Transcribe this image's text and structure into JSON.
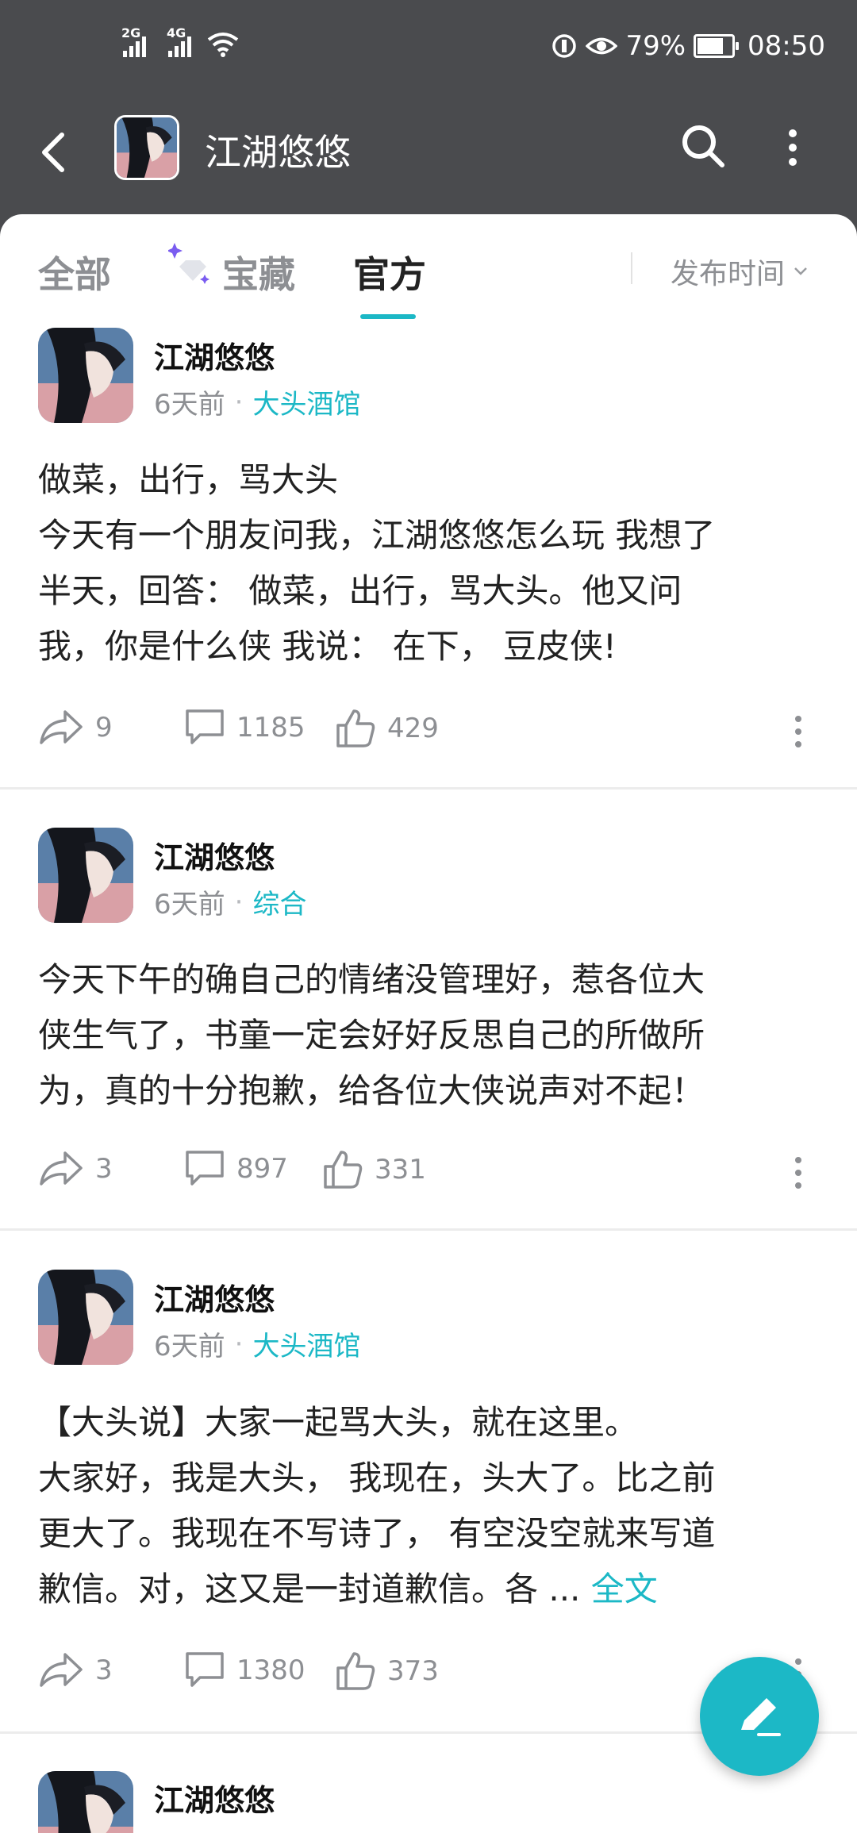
{
  "status_bar": {
    "net1": "2G",
    "net2": "4G",
    "battery_percent": "79%",
    "battery_level": 0.79,
    "time": "08:50"
  },
  "header": {
    "title": "江湖悠悠"
  },
  "tabs": [
    {
      "label": "全部"
    },
    {
      "label": "宝藏"
    },
    {
      "label": "官方"
    }
  ],
  "sort_label": "发布时间",
  "posts": [
    {
      "author": "江湖悠悠",
      "time": "6天前",
      "category": "大头酒馆",
      "body_lines": [
        "做菜，出行，骂大头",
        "今天有一个朋友问我，江湖悠悠怎么玩 我想了",
        "半天，回答： 做菜，出行，骂大头。他又问",
        "我，你是什么侠 我说： 在下， 豆皮侠!"
      ],
      "shares": "9",
      "comments": "1185",
      "likes": "429"
    },
    {
      "author": "江湖悠悠",
      "time": "6天前",
      "category": "综合",
      "body_lines": [
        "今天下午的确自己的情绪没管理好，惹各位大",
        "侠生气了，书童一定会好好反思自己的所做所",
        "为，真的十分抱歉，给各位大侠说声对不起！"
      ],
      "shares": "3",
      "comments": "897",
      "likes": "331"
    },
    {
      "author": "江湖悠悠",
      "time": "6天前",
      "category": "大头酒馆",
      "body_lines": [
        "【大头说】大家一起骂大头，就在这里。",
        "大家好，我是大头， 我现在，头大了。比之前",
        "更大了。我现在不写诗了， 有空没空就来写道",
        "歉信。对，这又是一封道歉信。各 ..."
      ],
      "full_text_label": "全文",
      "shares": "3",
      "comments": "1380",
      "likes": "373"
    },
    {
      "author": "江湖悠悠"
    }
  ]
}
